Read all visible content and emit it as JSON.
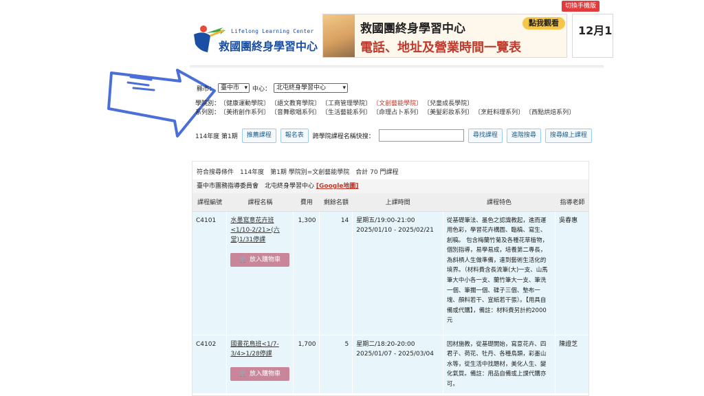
{
  "header": {
    "mobile_switch": "切換手機版",
    "logo_en": "Lifelong Learning Center",
    "logo_zh": "救國團終身學習中心",
    "banner_title": "救國團終身學習中心",
    "banner_subtitle": "電話、地址及營業時間一覽表",
    "banner_button": "點我觀看",
    "banner2_text": "12月1"
  },
  "filter": {
    "county_label": "縣市：",
    "county_value": "臺中市",
    "center_label": "中心：",
    "center_value": "北屯終身學習中心",
    "college_label": "學院別：",
    "colleges": [
      "〔健康運動學院〕",
      "〔語文教育學院〕",
      "〔工商管理學院〕",
      "〔文創藝能學院〕",
      "〔兒童成長學院〕"
    ],
    "series_label": "系列別：",
    "series": [
      "〔美術創作系列〕",
      "〔音舞歌唱系列〕",
      "〔生活藝能系列〕",
      "〔命理占卜系列〕",
      "〔美髮彩妝系列〕",
      "〔烹飪料理系列〕",
      "〔西點烘焙系列〕"
    ]
  },
  "actions": {
    "term": "114年度 第1期",
    "recommend": "推薦課程",
    "signup": "報名表",
    "search_label": "跨學院課程名稱快搜：",
    "find": "尋找課程",
    "advanced": "進階搜尋",
    "online": "搜尋線上課程"
  },
  "results": {
    "summary": "符合搜尋條件　114年度　第1期 學院別=文創藝能學院　合計 70 門課程",
    "org": "臺中市團務指導委員會　北屯終身學習中心",
    "gmap": "[Google地圖]",
    "headers": [
      "課程編號",
      "課程名稱",
      "費用",
      "剩餘名額",
      "上課時間",
      "課程特色",
      "指導老師"
    ],
    "rows": [
      {
        "code": "C4101",
        "name": "水墨寫意花卉班<1/10-2/21>(六堂)1/31停課",
        "fee": "1,300",
        "seats": "14",
        "time1": "星期五/19:00-21:00",
        "time2": "2025/01/10 - 2025/02/21",
        "feature": "從基礎筆法、墨色之認識教起，進而運用色彩，學習花卉構圖、臨稿、寫生、創稿。 包含梅蘭竹菊及各種花草植物，個別指導，易學易成，培養第二專長，為斜槓人生做準備，達到藝術生活化的境界。（材料費含長流筆(大)一支、山馬筆大中小各一支、蘭竹筆大一支、筆洗一個、筆擱一個、碟子三個、墊布一塊、顏料若干、宣紙若干張）。【用具自備或代購】，備註：材料費另計約2000元",
        "teacher": "吳春惠",
        "cart": "放入購物車"
      },
      {
        "code": "C4102",
        "name": "國畫花鳥班<1/7-3/4>1/28停課",
        "fee": "1,700",
        "seats": "5",
        "time1": "星期二/18:20-20:00",
        "time2": "2025/01/07 - 2025/03/04",
        "feature": "因材施教，從基礎開始，寫意花卉、四君子、荷花、牡丹、各種鳥類，彩墨山水等，從生活中找題材，美化人生、變化氣質。備註：用品自備或上課代購亦可。",
        "teacher": "陳證芝",
        "cart": "放入購物車"
      }
    ]
  },
  "colors": {
    "accent": "#c0392b",
    "brand": "#1b4fa3",
    "row_bg": "#e8f6fb",
    "cart": "#c9869a",
    "arrow": "#4a6fd6"
  }
}
